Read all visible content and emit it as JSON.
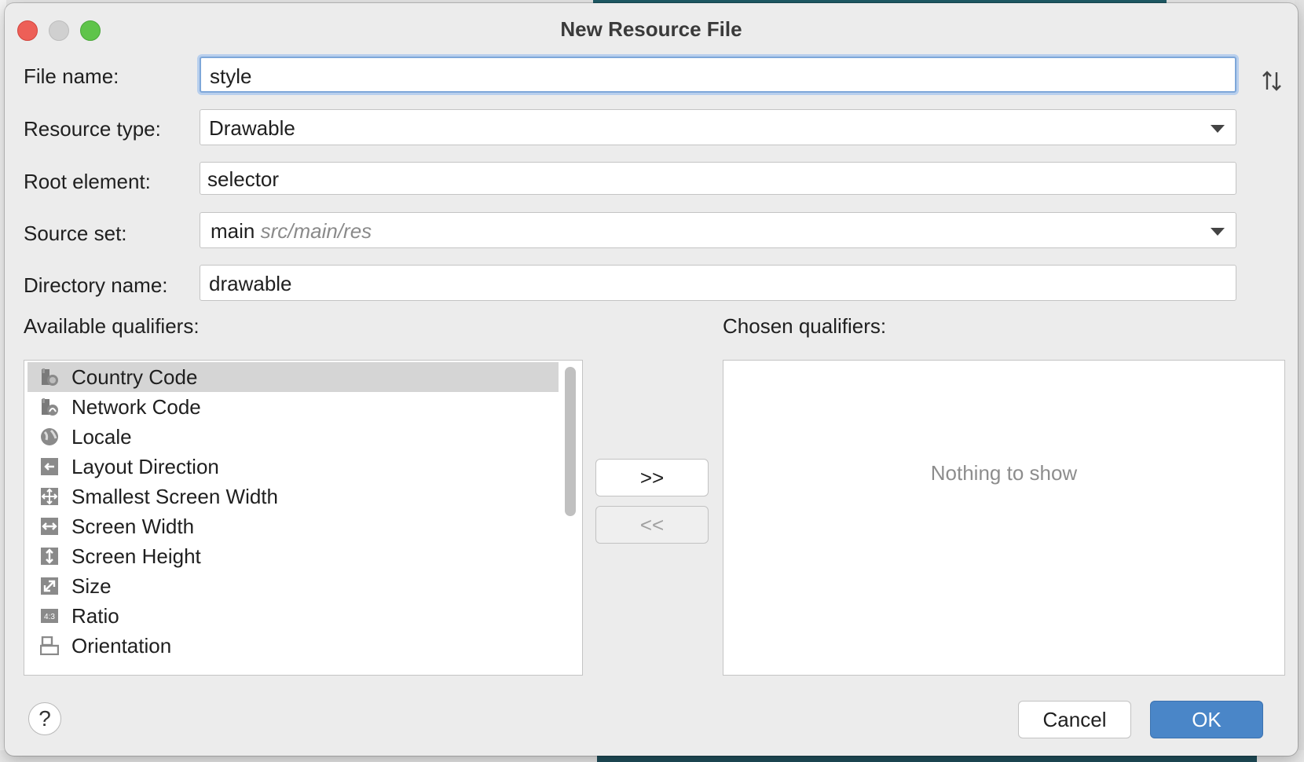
{
  "window": {
    "title": "New Resource File"
  },
  "form": {
    "file_name": {
      "label": "File name:",
      "value": "style"
    },
    "resource_type": {
      "label": "Resource type:",
      "value": "Drawable"
    },
    "root_element": {
      "label": "Root element:",
      "value": "selector"
    },
    "source_set": {
      "label": "Source set:",
      "value": "main",
      "path": "src/main/res"
    },
    "directory_name": {
      "label": "Directory name:",
      "value": "drawable"
    }
  },
  "available": {
    "label": "Available qualifiers:",
    "items": [
      {
        "label": "Country Code",
        "icon": "country-code-icon",
        "selected": true
      },
      {
        "label": "Network Code",
        "icon": "network-code-icon"
      },
      {
        "label": "Locale",
        "icon": "globe-icon"
      },
      {
        "label": "Layout Direction",
        "icon": "layout-direction-icon"
      },
      {
        "label": "Smallest Screen Width",
        "icon": "smallest-screen-width-icon"
      },
      {
        "label": "Screen Width",
        "icon": "screen-width-icon"
      },
      {
        "label": "Screen Height",
        "icon": "screen-height-icon"
      },
      {
        "label": "Size",
        "icon": "size-icon"
      },
      {
        "label": "Ratio",
        "icon": "ratio-icon"
      },
      {
        "label": "Orientation",
        "icon": "orientation-icon"
      }
    ]
  },
  "transfer": {
    "add_label": ">>",
    "remove_label": "<<"
  },
  "chosen": {
    "label": "Chosen qualifiers:",
    "empty_text": "Nothing to show"
  },
  "buttons": {
    "help_label": "?",
    "cancel_label": "Cancel",
    "ok_label": "OK"
  }
}
